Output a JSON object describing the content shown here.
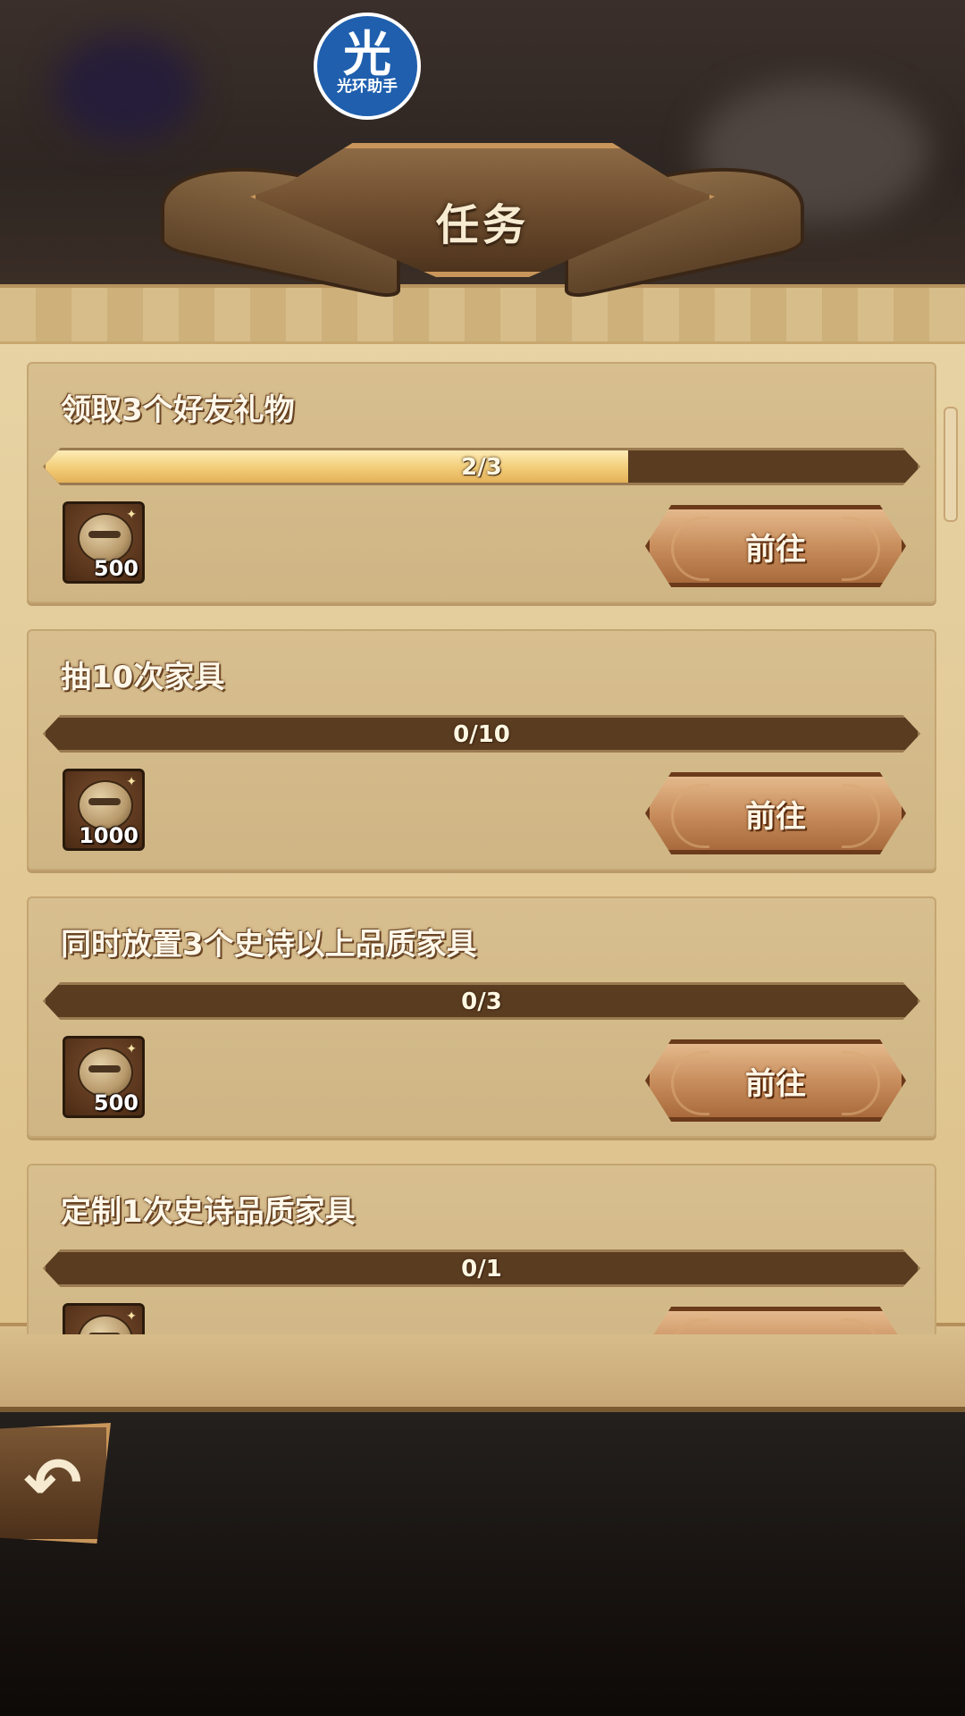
{
  "logo": {
    "char": "光",
    "caption": "光环助手"
  },
  "title": "任务",
  "tasks": [
    {
      "name": "领取3个好友礼物",
      "progress_text": "2/3",
      "progress": 0.667,
      "reward_qty": "500",
      "button": "前往"
    },
    {
      "name": "抽10次家具",
      "progress_text": "0/10",
      "progress": 0.0,
      "reward_qty": "1000",
      "button": "前往"
    },
    {
      "name": "同时放置3个史诗以上品质家具",
      "progress_text": "0/3",
      "progress": 0.0,
      "reward_qty": "500",
      "button": "前往"
    },
    {
      "name": "定制1次史诗品质家具",
      "progress_text": "0/1",
      "progress": 0.0,
      "reward_qty": "",
      "button": ""
    }
  ],
  "back_icon": "return-arrow-icon"
}
